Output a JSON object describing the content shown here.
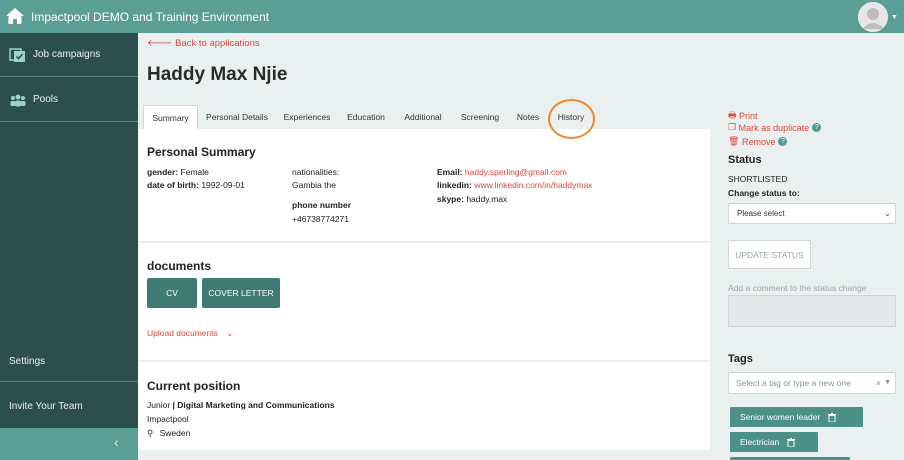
{
  "topbar": {
    "title": "Impactpool DEMO and Training Environment"
  },
  "sidebar": {
    "items": [
      {
        "label": "Job campaigns",
        "icon": "checklist-icon"
      },
      {
        "label": "Pools",
        "icon": "people-icon"
      }
    ],
    "settings_label": "Settings",
    "invite_label": "Invite Your Team",
    "collapse_glyph": "‹"
  },
  "main": {
    "back_label": "Back to applications",
    "candidate_name": "Haddy Max Njie",
    "tabs": [
      {
        "label": "Summary",
        "active": true
      },
      {
        "label": "Personal Details"
      },
      {
        "label": "Experiences"
      },
      {
        "label": "Education"
      },
      {
        "label": "Additional"
      },
      {
        "label": "Screening"
      },
      {
        "label": "Notes"
      },
      {
        "label": "History"
      }
    ],
    "personal_summary": {
      "heading": "Personal Summary",
      "gender_label": "gender:",
      "gender": "Female",
      "dob_label": "date of birth:",
      "dob": "1992-09-01",
      "nationalities_label": "nationalities:",
      "nationalities": "Gambia the",
      "phone_label": "phone number",
      "phone": "+46738774271",
      "email_label": "Email:",
      "email": "haddy.sperling@gmail.com",
      "linkedin_label": "linkedin:",
      "linkedin": "www.linkedin.com/in/haddymax",
      "skype_label": "skype:",
      "skype": "haddy.max"
    },
    "documents": {
      "heading": "documents",
      "cv_button": "CV",
      "cover_letter_button": "COVER LETTER",
      "upload_label": "Upload documents"
    },
    "current_position": {
      "heading": "Current position",
      "level": "Junior",
      "separator": "|",
      "title": "Digital Marketing and Communications",
      "company": "Impactpool",
      "location": "Sweden"
    }
  },
  "right": {
    "print_label": "Print",
    "duplicate_label": "Mark as duplicate",
    "remove_label": "Remove",
    "status_heading": "Status",
    "status_value": "SHORTLISTED",
    "change_status_label": "Change status to:",
    "status_select": "Please select",
    "update_button": "UPDATE STATUS",
    "comment_placeholder": "Add a comment to the status change",
    "tags_heading": "Tags",
    "tag_placeholder": "Select a tag or type a new one",
    "tag_clear": "×",
    "tags": [
      "Senior women leader",
      "Electrician"
    ]
  },
  "colors": {
    "brand": "#5b9e96",
    "sidebar": "#2d4f4c",
    "accent_red": "#e0473b",
    "teal_button": "#3f7a74",
    "highlight_ring": "#f08a2f"
  }
}
